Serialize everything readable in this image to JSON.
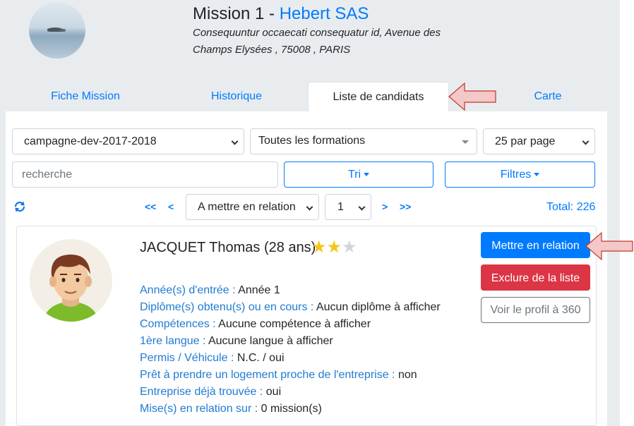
{
  "mission": {
    "title_prefix": "Mission 1 - ",
    "company": "Hebert SAS",
    "address_line1": "Consequuntur occaecati consequatur id, Avenue des",
    "address_line2": "Champs Elysées , 75008 , PARIS"
  },
  "tabs": [
    {
      "label": "Fiche Mission",
      "active": false
    },
    {
      "label": "Historique",
      "active": false
    },
    {
      "label": "Liste de candidats",
      "active": true
    },
    {
      "label": "Carte",
      "active": false
    }
  ],
  "filters": {
    "campaign": "campagne-dev-2017-2018",
    "formation": "Toutes les formations",
    "per_page": "25 par page",
    "search_placeholder": "recherche",
    "sort_label": "Tri",
    "filters_label": "Filtres"
  },
  "pager": {
    "first": "<<",
    "prev": "<",
    "status": "A mettre en relation",
    "page": "1",
    "next": ">",
    "last": ">>",
    "total": "Total: 226"
  },
  "candidate": {
    "name": "JACQUET Thomas (28 ans)",
    "rating": 2,
    "rating_max": 3,
    "fields": [
      {
        "label": "Année(s) d'entrée :",
        "value": " Année 1"
      },
      {
        "label": "Diplôme(s) obtenu(s) ou en cours :",
        "value": " Aucun diplôme à afficher"
      },
      {
        "label": "Compétences :",
        "value": " Aucune compétence à afficher"
      },
      {
        "label": "1ère langue :",
        "value": " Aucune langue à afficher"
      },
      {
        "label": "Permis / Véhicule :",
        "value": " N.C. / oui"
      },
      {
        "label": "Prêt à prendre un logement proche de l'entreprise :",
        "value": " non"
      },
      {
        "label": "Entreprise déjà trouvée :",
        "value": " oui"
      },
      {
        "label": "Mise(s) en relation sur :",
        "value": " 0 mission(s)"
      }
    ],
    "actions": {
      "connect": "Mettre en relation",
      "exclude": "Exclure de la liste",
      "profile": "Voir le profil à 360"
    }
  },
  "colors": {
    "primary": "#007bff",
    "danger": "#dc3545",
    "label_blue": "#1f7bd1",
    "page_bg": "#e9ecef",
    "arrow_fill": "#f4c7c8",
    "arrow_stroke": "#c0392b"
  },
  "icons": {
    "refresh": "refresh-icon",
    "dropdown": "chevron-down-icon",
    "star": "star-icon",
    "annotation_arrow": "arrow-left-icon"
  }
}
